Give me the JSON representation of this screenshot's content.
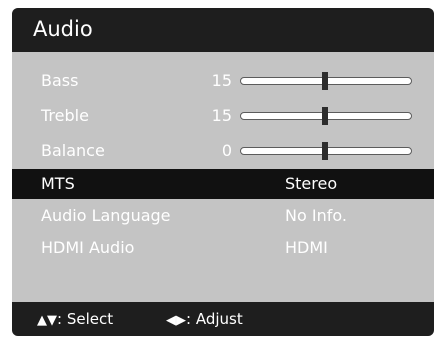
{
  "menu": {
    "title": "Audio",
    "sliders": [
      {
        "label": "Bass",
        "value": "15",
        "level": 0.5
      },
      {
        "label": "Treble",
        "value": "15",
        "level": 0.5
      },
      {
        "label": "Balance",
        "value": "0",
        "level": 0.5
      }
    ],
    "options": [
      {
        "label": "MTS",
        "value": "Stereo",
        "selected": true
      },
      {
        "label": "Audio Language",
        "value": "No Info.",
        "selected": false
      },
      {
        "label": "HDMI Audio",
        "value": "HDMI",
        "selected": false
      }
    ]
  },
  "footer": {
    "select_icon": "▲▼",
    "select_label": ": Select",
    "adjust_icon": "◀▶",
    "adjust_label": ": Adjust"
  },
  "colors": {
    "panel": "#c4c4c4",
    "header": "#1e1e1e",
    "selected_row": "#111111",
    "text": "#ffffff"
  }
}
